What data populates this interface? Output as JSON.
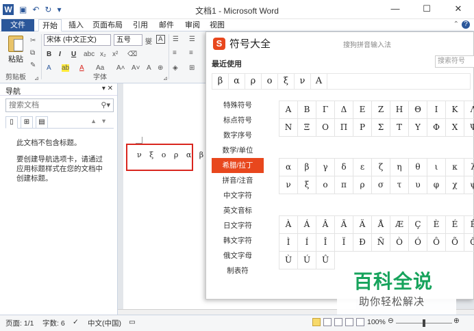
{
  "window": {
    "title": "文档1 - Microsoft Word",
    "controls": [
      "—",
      "☐",
      "✕"
    ]
  },
  "tabs": [
    {
      "label": "文件"
    },
    {
      "label": "开始"
    },
    {
      "label": "插入"
    },
    {
      "label": "页面布局"
    },
    {
      "label": "引用"
    },
    {
      "label": "邮件"
    },
    {
      "label": "审阅"
    },
    {
      "label": "视图"
    }
  ],
  "ribbon": {
    "paste_label": "粘贴",
    "clipboard_label": "剪贴板",
    "font_name": "宋体 (中文正文)",
    "font_size": "五号",
    "font_group_label": "字体",
    "bold": "B",
    "italic": "I",
    "underline": "U"
  },
  "navigation": {
    "title": "导航",
    "search_placeholder": "搜索文档",
    "message1": "此文档不包含标题。",
    "message2": "要创建导航选项卡，请通过应用标题样式在您的文档中创建标题。"
  },
  "document": {
    "text": "ν ξ ο ρ α β ↵"
  },
  "status": {
    "page": "页面: 1/1",
    "words": "字数: 6",
    "language": "中文(中国)",
    "zoom": "100%",
    "zoom_fraction": 0.5
  },
  "symbol_dialog": {
    "title": "符号大全",
    "ime_text": "搜狗拼音输入法",
    "search_placeholder": "搜索符号",
    "recent_label": "最近使用",
    "recent": [
      "β",
      "α",
      "ρ",
      "ο",
      "ξ",
      "ν",
      "Α"
    ],
    "categories": [
      "特殊符号",
      "标点符号",
      "数字序号",
      "数学/单位",
      "希腊/拉丁",
      "拼音/注音",
      "中文字符",
      "英文音标",
      "日文字符",
      "韩文字符",
      "俄文字母",
      "制表符"
    ],
    "active_category": "希腊/拉丁",
    "greek_upper": [
      "Α",
      "Β",
      "Γ",
      "Δ",
      "Ε",
      "Ζ",
      "Η",
      "Θ",
      "Ι",
      "Κ",
      "Λ",
      "Ν",
      "Ξ",
      "Ο",
      "Π",
      "Ρ",
      "Σ",
      "Τ",
      "Υ",
      "Φ",
      "Χ",
      "Ψ"
    ],
    "greek_lower": [
      "α",
      "β",
      "γ",
      "δ",
      "ε",
      "ζ",
      "η",
      "θ",
      "ι",
      "κ",
      "λ",
      "ν",
      "ξ",
      "ο",
      "π",
      "ρ",
      "σ",
      "τ",
      "υ",
      "φ",
      "χ",
      "ψ"
    ],
    "latin_accented": [
      "À",
      "Á",
      "Â",
      "Ã",
      "Ä",
      "Å",
      "Æ",
      "Ç",
      "È",
      "É",
      "Ê",
      "Ì",
      "Í",
      "Î",
      "Ï",
      "Ð",
      "Ñ",
      "Ò",
      "Ó",
      "Ô",
      "Õ",
      "Ö",
      "Ù",
      "Ú",
      "Û"
    ]
  },
  "watermark": {
    "title": "百科全说",
    "subtitle": "助你轻松解决"
  }
}
